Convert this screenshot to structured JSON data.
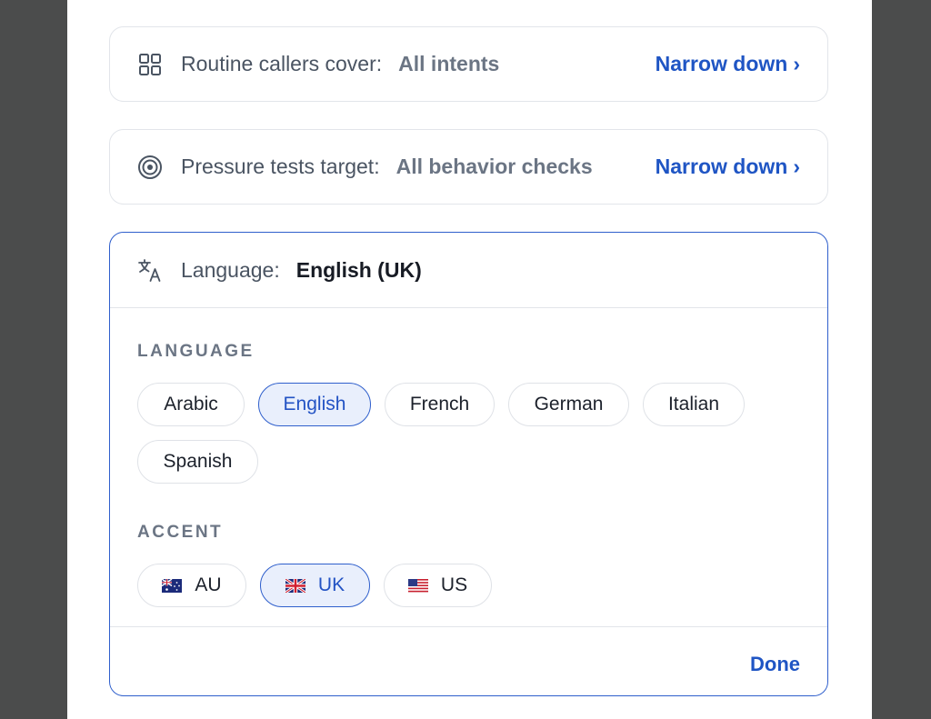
{
  "rows": {
    "intents": {
      "icon": "grid-icon",
      "label": "Routine callers cover:",
      "value": "All intents",
      "link": "Narrow down",
      "chevron": "›"
    },
    "pressure": {
      "icon": "target-icon",
      "label": "Pressure tests target:",
      "value": "All behavior checks",
      "link": "Narrow down",
      "chevron": "›"
    }
  },
  "language_card": {
    "icon": "translate-icon",
    "label": "Language:",
    "value": "English (UK)",
    "language_section_title": "LANGUAGE",
    "languages": [
      {
        "label": "Arabic",
        "selected": false
      },
      {
        "label": "English",
        "selected": true
      },
      {
        "label": "French",
        "selected": false
      },
      {
        "label": "German",
        "selected": false
      },
      {
        "label": "Italian",
        "selected": false
      },
      {
        "label": "Spanish",
        "selected": false
      }
    ],
    "accent_section_title": "ACCENT",
    "accents": [
      {
        "label": "AU",
        "flag": "australia-flag-icon",
        "selected": false
      },
      {
        "label": "UK",
        "flag": "uk-flag-icon",
        "selected": true
      },
      {
        "label": "US",
        "flag": "us-flag-icon",
        "selected": false
      }
    ],
    "done_label": "Done"
  },
  "colors": {
    "accent": "#1f55c4",
    "selected_border": "#2f5fcc",
    "selected_fill": "#e9effc",
    "backdrop": "#4b4c4c"
  }
}
